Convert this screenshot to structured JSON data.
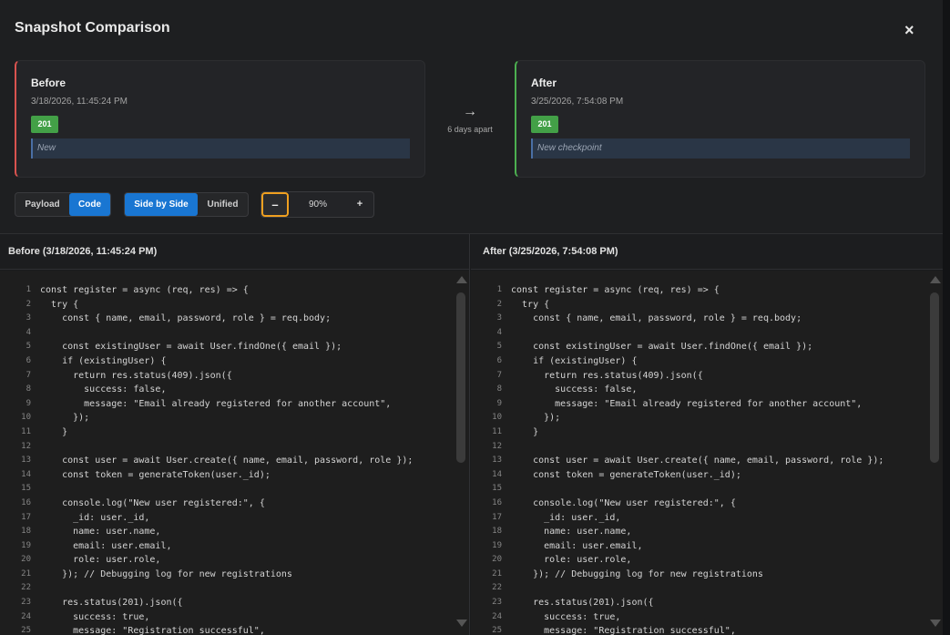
{
  "title": "Snapshot Comparison",
  "close_label": "×",
  "before": {
    "label": "Before",
    "date": "3/18/2026, 11:45:24 PM",
    "status": "201",
    "message": "New"
  },
  "after": {
    "label": "After",
    "date": "3/25/2026, 7:54:08 PM",
    "status": "201",
    "message": "New checkpoint"
  },
  "apart": {
    "arrow": "→",
    "text": "6 days apart"
  },
  "toolbar": {
    "payload": "Payload",
    "code": "Code",
    "side_by_side": "Side by Side",
    "unified": "Unified",
    "zoom_minus": "–",
    "zoom_value": "90%",
    "zoom_plus": "+"
  },
  "left_pane": {
    "title": "Before (3/18/2026, 11:45:24 PM)"
  },
  "right_pane": {
    "title": "After (3/25/2026, 7:54:08 PM)"
  },
  "code_lines": [
    "const register = async (req, res) => {",
    "  try {",
    "    const { name, email, password, role } = req.body;",
    "",
    "    const existingUser = await User.findOne({ email });",
    "    if (existingUser) {",
    "      return res.status(409).json({",
    "        success: false,",
    "        message: \"Email already registered for another account\",",
    "      });",
    "    }",
    "",
    "    const user = await User.create({ name, email, password, role });",
    "    const token = generateToken(user._id);",
    "",
    "    console.log(\"New user registered:\", {",
    "      _id: user._id,",
    "      name: user.name,",
    "      email: user.email,",
    "      role: user.role,",
    "    }); // Debugging log for new registrations",
    "",
    "    res.status(201).json({",
    "      success: true,",
    "      message: \"Registration successful\","
  ],
  "colors": {
    "accent": "#1976d2",
    "before_border": "#d9534f",
    "after_border": "#4caf50",
    "status_badge": "#43a047",
    "zoom_focus": "#f0a020"
  }
}
